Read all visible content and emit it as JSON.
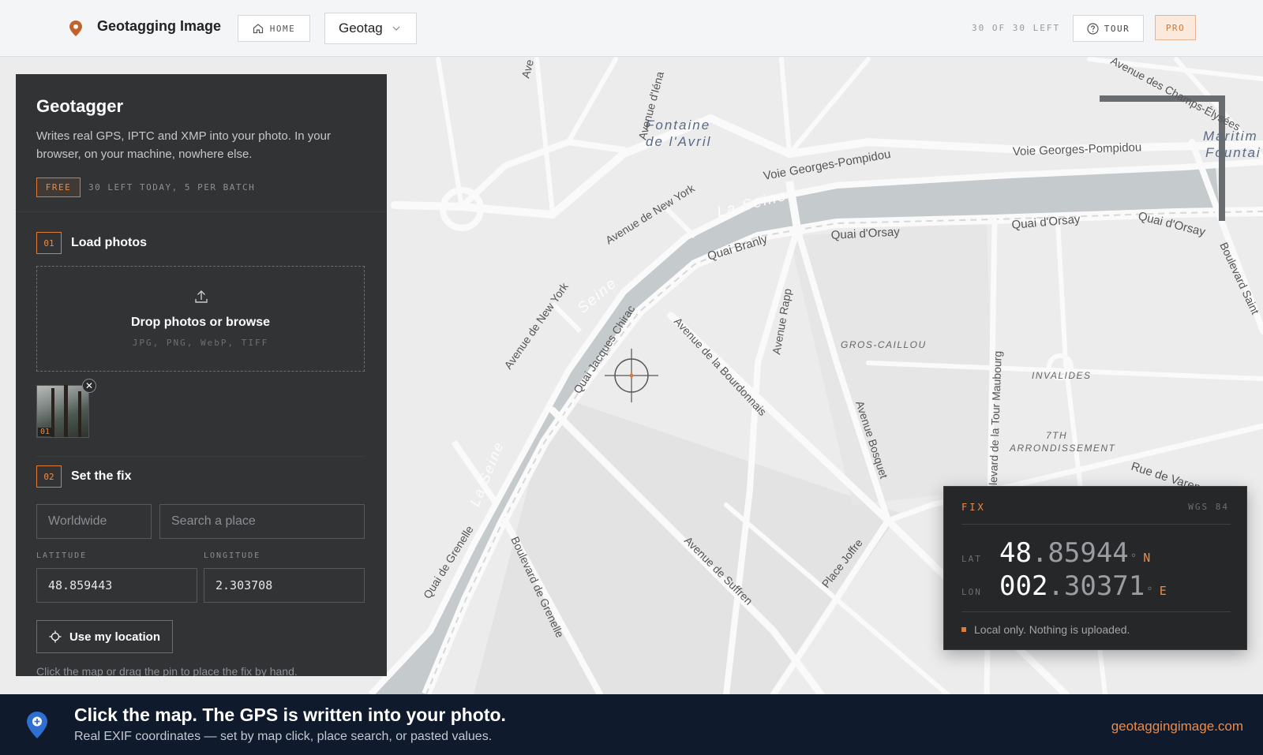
{
  "header": {
    "app_title": "Geotagging Image",
    "home_label": "HOME",
    "mode_select": "Geotag",
    "counter": "30 OF 30 LEFT",
    "tour_label": "TOUR",
    "pro_label": "PRO"
  },
  "map": {
    "labels": {
      "fontaine": "Fontaine",
      "de_lavril": "de l'Avril",
      "voie_gp_1": "Voie Georges-Pompidou",
      "voie_gp_2": "Voie Georges-Pompidou",
      "avenue_ny": "Avenue de New York",
      "avenue_ny_2": "Avenue de New York",
      "la_seine_1": "La Seine",
      "la_seine_2": "Seine",
      "la_seine_3": "La Seine",
      "quai_orsay_1": "Quai d'Orsay",
      "quai_orsay_2": "Quai d'Orsay",
      "quai_orsay_3": "Quai d'Orsay",
      "quai_branly": "Quai Branly",
      "quai_jc": "Quai Jacques Chirac",
      "av_rapp": "Avenue Rapp",
      "av_bourdonnais": "Avenue de la Bourdonnais",
      "gros_caillou": "GROS-CAILLOU",
      "invalides": "INVALIDES",
      "av_bosquet": "Avenue Bosquet",
      "bd_tour_maubourg": "Boulevard de la Tour Maubourg",
      "seventh": "7TH",
      "arrondissement": "ARRONDISSEMENT",
      "rue_varenne": "Rue de Varenne",
      "av_suffren": "Avenue de Suffren",
      "place_joffre": "Place Joffre",
      "bd_grenelle": "Boulevard de Grenelle",
      "quai_grenelle": "Quai de Grenelle",
      "av_iena": "Avenue d'Iéna",
      "champs": "Avenue des Champs-Élysées",
      "maritime": "Maritim",
      "fountain": "Fountai",
      "bd_saint": "Boulevard Saint",
      "av_short": "Ave"
    }
  },
  "panel": {
    "title": "Geotagger",
    "description": "Writes real GPS, IPTC and XMP into your photo. In your browser, on your machine, nowhere else.",
    "free_badge": "FREE",
    "free_note": "30 LEFT TODAY, 5 PER BATCH",
    "step1": {
      "num": "01",
      "label": "Load photos"
    },
    "dropzone": {
      "title": "Drop photos or browse",
      "types": "JPG, PNG, WebP, TIFF"
    },
    "thumb_num": "01",
    "step2": {
      "num": "02",
      "label": "Set the fix"
    },
    "region": "Worldwide",
    "search_placeholder": "Search a place",
    "lat_label": "LATITUDE",
    "lon_label": "LONGITUDE",
    "lat_value": "48.859443",
    "lon_value": "2.303708",
    "use_location": "Use my location",
    "hint": "Click the map or drag the pin to place the fix by hand."
  },
  "fix": {
    "title": "FIX",
    "datum": "WGS 84",
    "lat_label": "LAT",
    "lat_int": "48",
    "lat_dec": ".85944",
    "lat_hemi": "N",
    "lon_label": "LON",
    "lon_int": "002",
    "lon_dec": ".30371",
    "lon_hemi": "E",
    "degree": "°",
    "note": "Local only. Nothing is uploaded."
  },
  "footer": {
    "title": "Click the map. The GPS is written into your photo.",
    "subtitle": "Real EXIF coordinates — set by map click, place search, or pasted values.",
    "url": "geotaggingimage.com"
  },
  "colors": {
    "accent": "#f08a45",
    "panel_bg": "#242527",
    "footer_bg": "#0f1a2c",
    "water": "#c5cacd"
  }
}
